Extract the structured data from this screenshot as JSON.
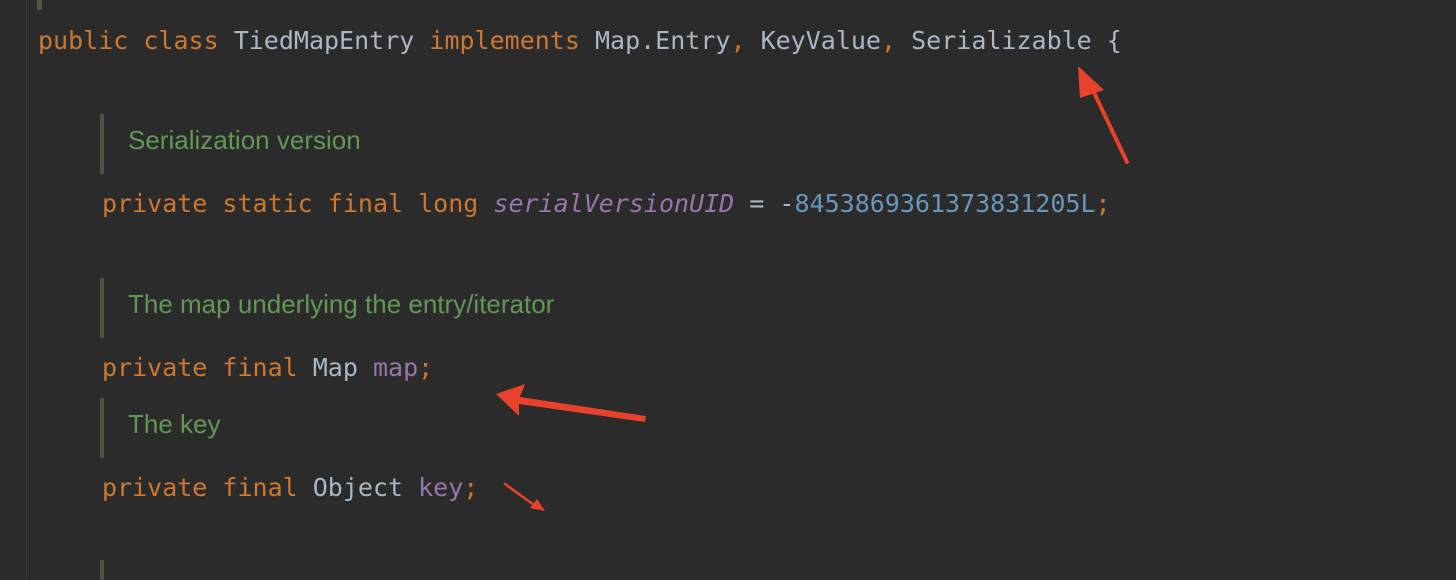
{
  "editor": {
    "class_decl": {
      "kw_public": "public",
      "kw_class": "class",
      "class_name": "TiedMapEntry",
      "kw_implements": "implements",
      "iface1": "Map.Entry",
      "comma1": ",",
      "iface2": "KeyValue",
      "comma2": ",",
      "iface3": "Serializable",
      "brace": "{"
    },
    "doc_serialization": "Serialization version",
    "line_serial": {
      "kw_private": "private",
      "kw_static": "static",
      "kw_final": "final",
      "type": "long",
      "name": "serialVersionUID",
      "eq": "=",
      "minus": "-",
      "value": "8453869361373831205L",
      "semicolon": ";"
    },
    "doc_map": "The map underlying the entry/iterator",
    "line_map": {
      "kw_private": "private",
      "kw_final": "final",
      "type": "Map",
      "name": "map",
      "semicolon": ";"
    },
    "doc_key": "The key",
    "line_key": {
      "kw_private": "private",
      "kw_final": "final",
      "type": "Object",
      "name": "key",
      "semicolon": ";"
    }
  },
  "colors": {
    "background": "#2b2b2b",
    "keyword": "#cc7832",
    "identifier": "#a9b7c6",
    "field": "#9876aa",
    "number": "#6897bb",
    "doc_comment": "#629755",
    "annotation_arrow": "#e8412c"
  }
}
